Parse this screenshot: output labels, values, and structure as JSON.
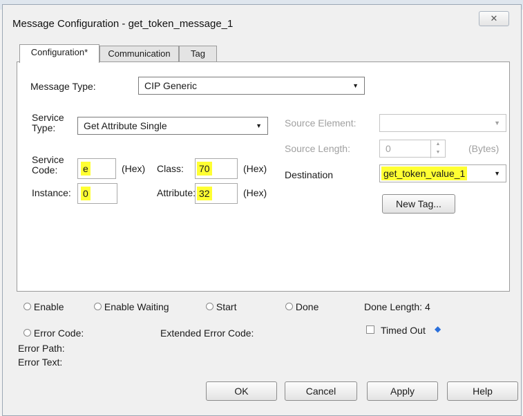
{
  "window": {
    "title": "Message Configuration - get_token_message_1",
    "close_glyph": "✕"
  },
  "tabs": [
    "Configuration*",
    "Communication",
    "Tag"
  ],
  "config": {
    "message_type_label": "Message Type:",
    "message_type_value": "CIP Generic",
    "service_type_label": "Service\nType:",
    "service_type_value": "Get Attribute Single",
    "service_code_label": "Service\nCode:",
    "service_code_value": "e",
    "hex_label": "(Hex)",
    "class_label": "Class:",
    "class_value": "70",
    "instance_label": "Instance:",
    "instance_value": "0",
    "attribute_label": "Attribute:",
    "attribute_value": "32",
    "source_element_label": "Source Element:",
    "source_element_value": "",
    "source_length_label": "Source Length:",
    "source_length_value": "0",
    "bytes_label": "(Bytes)",
    "destination_label": "Destination",
    "destination_value": "get_token_value_1",
    "new_tag_label": "New Tag..."
  },
  "status": {
    "enable": "Enable",
    "enable_waiting": "Enable Waiting",
    "start": "Start",
    "done": "Done",
    "done_length": "Done Length: 4",
    "error_code": "Error Code:",
    "extended_error_code": "Extended Error Code:",
    "timed_out": "Timed Out",
    "error_path": "Error Path:",
    "error_text": "Error Text:"
  },
  "buttons": {
    "ok": "OK",
    "cancel": "Cancel",
    "apply": "Apply",
    "help": "Help"
  },
  "colors": {
    "highlight": "#ffff32",
    "accent_arrow": "#2a6fdb"
  }
}
